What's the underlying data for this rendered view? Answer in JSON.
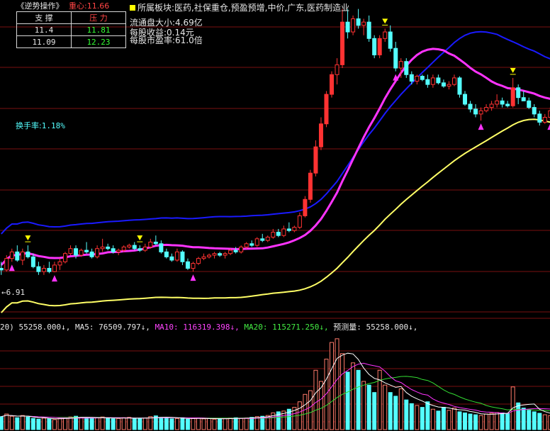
{
  "panel": {
    "title": "《逆势操作》",
    "center_label": "重心:",
    "center_value": "11.66",
    "support_header": "支 撑",
    "pressure_header": "压 力",
    "rows": [
      {
        "support": "11.4",
        "pressure": "11.81"
      },
      {
        "support": "11.09",
        "pressure": "12.23"
      }
    ],
    "turnover_label": "换手率:",
    "turnover_value": "1.18%",
    "low_marker_label": "6.91"
  },
  "info": {
    "sector": "所属板块:医药,社保重仓,预盈预增,中价,广东,医药制造业",
    "float_cap": "流通盘大小:4.69亿",
    "eps": "每股收益:0.14元",
    "pe": "每股市盈率:61.0倍"
  },
  "volume_legend": [
    {
      "text": "20) 55258.000↓,",
      "color": "#e8e8e8"
    },
    {
      "text": "MA5: 76509.797↓,",
      "color": "#e8e8e8"
    },
    {
      "text": "MA10: 116319.398↓,",
      "color": "#ff44ff"
    },
    {
      "text": "MA20: 115271.250↓,",
      "color": "#44ee44"
    },
    {
      "text": "预测量: 55258.000↓,",
      "color": "#e8e8e8"
    }
  ],
  "colors": {
    "up": "#ff3232",
    "down": "#54ffff",
    "ma_blue": "#1a1aff",
    "ma_magenta": "#ff33ff",
    "ma_yellow": "#ffff66",
    "grid": "#7a1010",
    "vol_ma5": "#ffffff",
    "vol_ma10": "#ff33ff",
    "vol_ma20": "#33dd33"
  },
  "chart_data": {
    "type": "candlestick",
    "price_range": [
      5.5,
      15.0
    ],
    "candles": [
      [
        7.0,
        7.2,
        6.8,
        6.95
      ],
      [
        6.95,
        7.4,
        6.9,
        7.3
      ],
      [
        7.3,
        7.6,
        7.2,
        7.5
      ],
      [
        7.5,
        7.7,
        7.2,
        7.25
      ],
      [
        7.25,
        7.6,
        7.1,
        7.5
      ],
      [
        7.5,
        7.7,
        7.3,
        7.35
      ],
      [
        7.35,
        7.45,
        7.0,
        7.05
      ],
      [
        7.05,
        7.2,
        6.8,
        6.9
      ],
      [
        6.9,
        7.1,
        6.8,
        7.0
      ],
      [
        7.0,
        7.2,
        6.85,
        6.9
      ],
      [
        6.9,
        7.2,
        6.88,
        7.1
      ],
      [
        7.1,
        7.3,
        6.95,
        7.2
      ],
      [
        7.2,
        7.5,
        7.15,
        7.45
      ],
      [
        7.45,
        7.7,
        7.4,
        7.6
      ],
      [
        7.6,
        7.7,
        7.3,
        7.4
      ],
      [
        7.4,
        7.6,
        7.35,
        7.55
      ],
      [
        7.55,
        7.8,
        7.45,
        7.5
      ],
      [
        7.5,
        7.6,
        7.3,
        7.35
      ],
      [
        7.35,
        7.7,
        7.3,
        7.6
      ],
      [
        7.6,
        7.9,
        7.5,
        7.65
      ],
      [
        7.65,
        7.75,
        7.55,
        7.6
      ],
      [
        7.6,
        7.7,
        7.45,
        7.5
      ],
      [
        7.5,
        7.6,
        7.4,
        7.55
      ],
      [
        7.55,
        7.7,
        7.5,
        7.65
      ],
      [
        7.65,
        7.75,
        7.6,
        7.7
      ],
      [
        7.7,
        7.8,
        7.55,
        7.6
      ],
      [
        7.6,
        7.7,
        7.5,
        7.55
      ],
      [
        7.55,
        7.75,
        7.5,
        7.65
      ],
      [
        7.65,
        7.9,
        7.6,
        7.8
      ],
      [
        7.8,
        8.0,
        7.7,
        7.75
      ],
      [
        7.75,
        7.85,
        7.45,
        7.5
      ],
      [
        7.5,
        7.6,
        7.3,
        7.35
      ],
      [
        7.35,
        7.45,
        7.2,
        7.25
      ],
      [
        7.25,
        7.6,
        7.2,
        7.5
      ],
      [
        7.5,
        7.55,
        7.1,
        7.2
      ],
      [
        7.2,
        7.3,
        6.95,
        7.0
      ],
      [
        7.0,
        7.2,
        6.9,
        7.15
      ],
      [
        7.15,
        7.35,
        7.1,
        7.3
      ],
      [
        7.3,
        7.45,
        7.25,
        7.35
      ],
      [
        7.35,
        7.45,
        7.3,
        7.4
      ],
      [
        7.4,
        7.5,
        7.3,
        7.45
      ],
      [
        7.45,
        7.5,
        7.35,
        7.4
      ],
      [
        7.4,
        7.5,
        7.3,
        7.45
      ],
      [
        7.45,
        7.6,
        7.4,
        7.55
      ],
      [
        7.55,
        7.65,
        7.45,
        7.5
      ],
      [
        7.5,
        7.7,
        7.45,
        7.65
      ],
      [
        7.65,
        7.8,
        7.6,
        7.75
      ],
      [
        7.75,
        7.85,
        7.65,
        7.7
      ],
      [
        7.7,
        7.95,
        7.65,
        7.9
      ],
      [
        7.9,
        8.05,
        7.8,
        7.85
      ],
      [
        7.85,
        8.0,
        7.8,
        7.95
      ],
      [
        7.95,
        8.2,
        7.9,
        8.1
      ],
      [
        8.1,
        8.2,
        7.95,
        8.0
      ],
      [
        8.0,
        8.3,
        7.95,
        8.2
      ],
      [
        8.2,
        8.4,
        8.1,
        8.15
      ],
      [
        8.15,
        8.3,
        8.1,
        8.25
      ],
      [
        8.25,
        8.7,
        8.2,
        8.6
      ],
      [
        8.6,
        9.2,
        8.55,
        9.1
      ],
      [
        9.1,
        10.0,
        9.0,
        9.9
      ],
      [
        9.9,
        10.9,
        9.8,
        10.7
      ],
      [
        10.7,
        11.6,
        10.6,
        11.4
      ],
      [
        11.4,
        12.4,
        11.3,
        12.3
      ],
      [
        12.3,
        13.0,
        12.2,
        12.9
      ],
      [
        12.9,
        13.4,
        12.6,
        13.2
      ],
      [
        13.2,
        14.9,
        13.1,
        14.5
      ],
      [
        14.5,
        14.9,
        14.0,
        14.2
      ],
      [
        14.2,
        14.7,
        14.1,
        14.6
      ],
      [
        14.6,
        14.9,
        14.3,
        14.4
      ],
      [
        14.4,
        14.6,
        14.1,
        14.5
      ],
      [
        14.5,
        14.7,
        13.9,
        14.0
      ],
      [
        14.0,
        14.1,
        13.4,
        13.5
      ],
      [
        13.5,
        14.1,
        13.4,
        14.0
      ],
      [
        14.0,
        14.3,
        13.9,
        14.2
      ],
      [
        14.2,
        14.4,
        13.6,
        13.7
      ],
      [
        13.7,
        13.9,
        13.0,
        13.1
      ],
      [
        13.1,
        13.4,
        12.8,
        13.3
      ],
      [
        13.3,
        13.4,
        12.8,
        12.9
      ],
      [
        12.9,
        13.0,
        12.6,
        12.7
      ],
      [
        12.7,
        12.9,
        12.6,
        12.85
      ],
      [
        12.85,
        12.9,
        12.7,
        12.75
      ],
      [
        12.75,
        12.9,
        12.5,
        12.6
      ],
      [
        12.6,
        12.9,
        12.5,
        12.8
      ],
      [
        12.8,
        12.9,
        12.6,
        12.65
      ],
      [
        12.65,
        12.75,
        12.5,
        12.55
      ],
      [
        12.55,
        12.7,
        12.45,
        12.6
      ],
      [
        12.6,
        12.9,
        12.55,
        12.8
      ],
      [
        12.8,
        12.85,
        12.2,
        12.3
      ],
      [
        12.3,
        12.4,
        11.95,
        12.0
      ],
      [
        12.0,
        12.1,
        11.75,
        11.85
      ],
      [
        11.85,
        12.0,
        11.6,
        11.7
      ],
      [
        11.7,
        11.9,
        11.5,
        11.8
      ],
      [
        11.8,
        12.0,
        11.75,
        11.9
      ],
      [
        11.9,
        12.1,
        11.8,
        12.0
      ],
      [
        12.0,
        12.3,
        11.9,
        12.1
      ],
      [
        12.1,
        12.2,
        11.9,
        12.0
      ],
      [
        12.0,
        12.1,
        11.9,
        11.95
      ],
      [
        11.95,
        12.8,
        11.9,
        12.5
      ],
      [
        12.5,
        12.6,
        12.0,
        12.2
      ],
      [
        12.2,
        12.4,
        12.1,
        12.1
      ],
      [
        12.1,
        12.2,
        11.85,
        11.9
      ],
      [
        11.9,
        12.0,
        11.6,
        11.7
      ],
      [
        11.7,
        11.8,
        11.35,
        11.45
      ],
      [
        11.45,
        11.7,
        11.4,
        11.6
      ],
      [
        11.6,
        11.9,
        11.5,
        11.8
      ]
    ],
    "volume_range": [
      0,
      260000
    ],
    "volumes": [
      35000,
      42000,
      36000,
      32000,
      38000,
      34000,
      30000,
      28000,
      31000,
      29000,
      27000,
      30000,
      32000,
      34000,
      36000,
      33000,
      31000,
      30000,
      32000,
      34000,
      31000,
      29000,
      30000,
      32000,
      33000,
      30000,
      29000,
      31000,
      35000,
      37000,
      33000,
      31000,
      29000,
      30000,
      32000,
      28000,
      30000,
      31000,
      29000,
      30000,
      28000,
      29000,
      30000,
      31000,
      32000,
      30000,
      31000,
      33000,
      35000,
      36000,
      38000,
      45000,
      48000,
      50000,
      55000,
      60000,
      75000,
      95000,
      105000,
      160000,
      130000,
      190000,
      235000,
      245000,
      205000,
      155000,
      180000,
      160000,
      130000,
      120000,
      100000,
      160000,
      120000,
      100000,
      90000,
      110000,
      80000,
      70000,
      65000,
      60000,
      75000,
      55000,
      50000,
      60000,
      52000,
      58000,
      48000,
      45000,
      42000,
      40000,
      38000,
      42000,
      44000,
      46000,
      45000,
      43000,
      115000,
      72000,
      58000,
      52000,
      48000,
      44000,
      40000,
      38000
    ],
    "buy_markers": [
      2,
      10,
      36,
      74,
      90,
      103
    ],
    "sell_markers": [
      5,
      26,
      72,
      96
    ],
    "low_marker_index": 0
  }
}
